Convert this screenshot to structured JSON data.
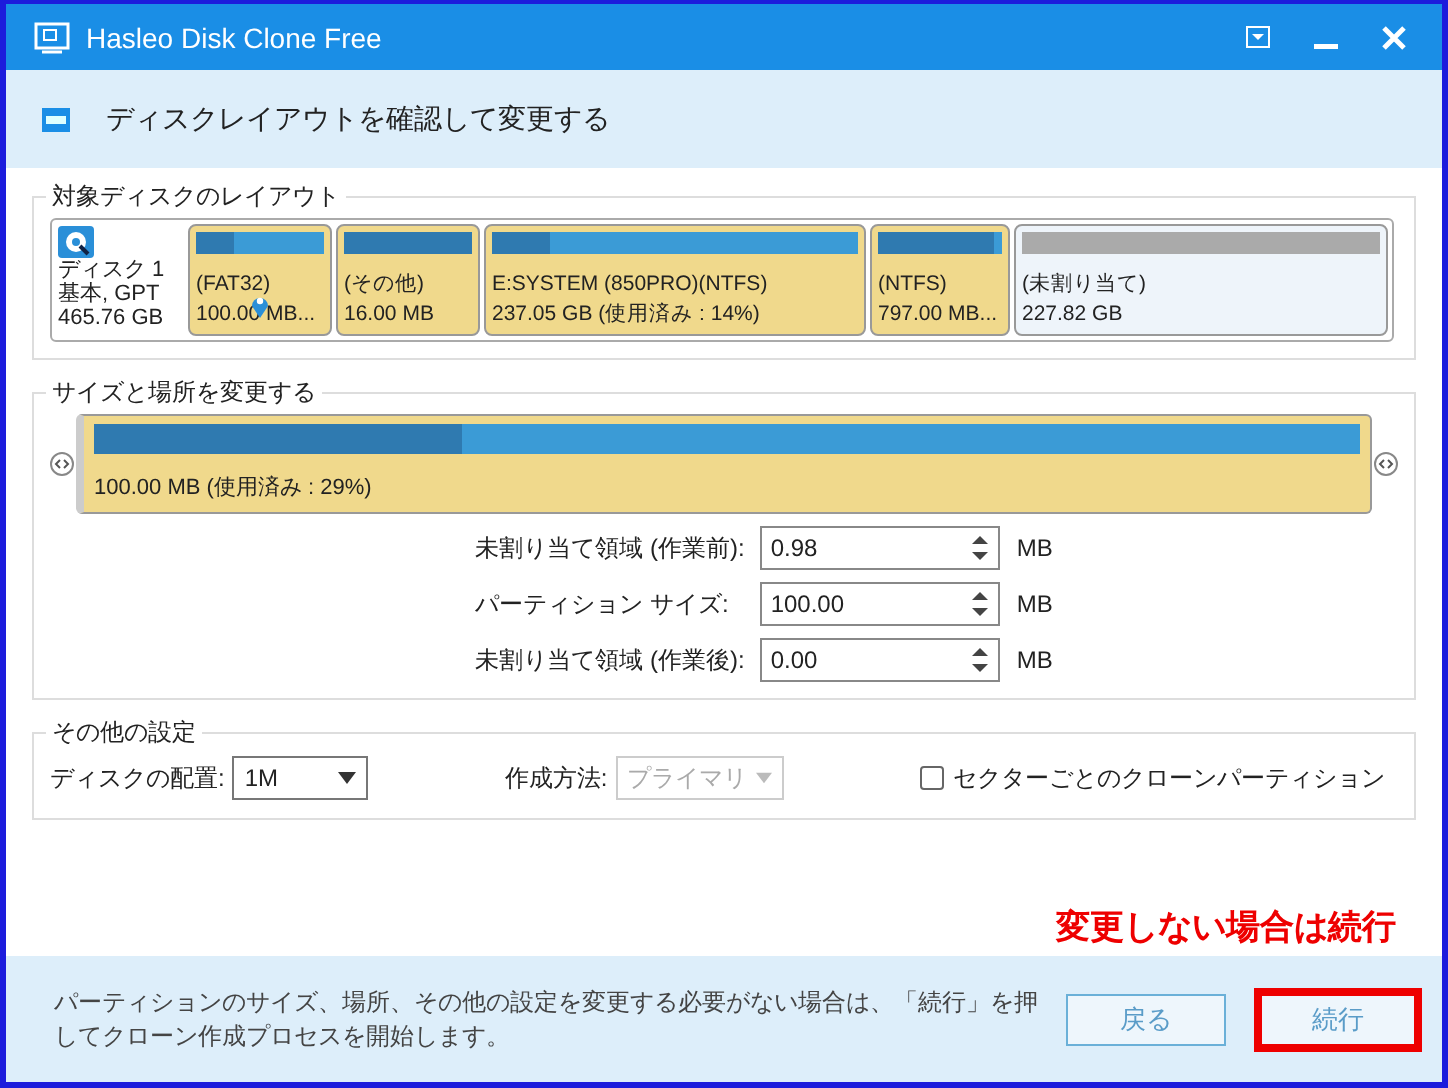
{
  "window": {
    "title": "Hasleo Disk Clone Free"
  },
  "header": {
    "title": "ディスクレイアウトを確認して変更する"
  },
  "target_layout": {
    "legend": "対象ディスクのレイアウト",
    "disk": {
      "lines": [
        "ディスク 1",
        "基本, GPT",
        "465.76 GB"
      ]
    },
    "partitions": [
      {
        "kind": "partition",
        "label": "(FAT32)",
        "size": "100.00 MB...",
        "level": 0.29,
        "selected": true
      },
      {
        "kind": "partition",
        "label": "(その他)",
        "size": "16.00 MB",
        "level": 1,
        "selected": false
      },
      {
        "kind": "partition",
        "label": "E:SYSTEM (850PRO)(NTFS)",
        "size": "237.05 GB (使用済み : 14%)",
        "level": 0.16,
        "selected": false
      },
      {
        "kind": "partition",
        "label": "(NTFS)",
        "size": "797.00 MB...",
        "level": 0.93,
        "selected": false
      },
      {
        "kind": "unallocated",
        "label": "(未割り当て)",
        "size": "227.82 GB",
        "selected": false
      }
    ]
  },
  "resize": {
    "legend": "サイズと場所を変更する",
    "partition": {
      "level": 0.29,
      "text": "100.00 MB (使用済み : 29%)"
    },
    "fields": [
      {
        "label": "未割り当て領域 (作業前):",
        "value": "0.98",
        "unit": "MB"
      },
      {
        "label": "パーティション サイズ:",
        "value": "100.00",
        "unit": "MB"
      },
      {
        "label": "未割り当て領域 (作業後):",
        "value": "0.00",
        "unit": "MB"
      }
    ]
  },
  "other": {
    "legend": "その他の設定",
    "alignment": {
      "label": "ディスクの配置:",
      "value": "1M"
    },
    "method": {
      "label": "作成方法:",
      "value": "プライマリ",
      "disabled": true
    },
    "sector_clone": {
      "label": "セクターごとのクローンパーティション",
      "checked": false
    }
  },
  "annotation": {
    "text": "変更しない場合は続行"
  },
  "footer": {
    "message": "パーティションのサイズ、場所、その他の設定を変更する必要がない場合は、「続行」を押してクローン作成プロセスを開始します。",
    "buttons": [
      {
        "label": "戻る",
        "highlighted": false
      },
      {
        "label": "続行",
        "highlighted": true
      }
    ]
  }
}
